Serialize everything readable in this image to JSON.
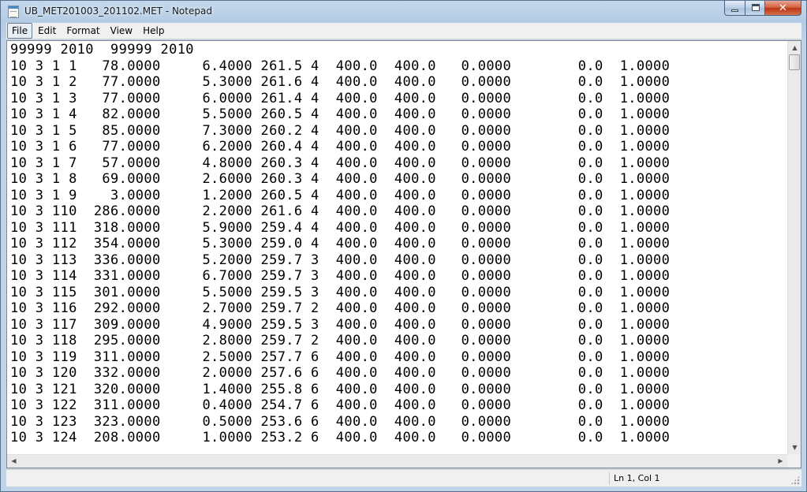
{
  "window": {
    "title": "UB_MET201003_201102.MET - Notepad",
    "app_icon": "notepad-icon",
    "controls": {
      "minimize_icon": "minimize-icon",
      "maximize_icon": "maximize-icon",
      "close_icon": "close-icon",
      "close_glyph": "✕"
    },
    "close_color": "#c7401f"
  },
  "menu": {
    "items": [
      {
        "label": "File"
      },
      {
        "label": "Edit"
      },
      {
        "label": "Format"
      },
      {
        "label": "View"
      },
      {
        "label": "Help"
      }
    ],
    "active_index": 0
  },
  "document": {
    "lines": [
      "99999 2010  99999 2010",
      "10 3 1 1   78.0000     6.4000 261.5 4  400.0  400.0   0.0000        0.0  1.0000",
      "10 3 1 2   77.0000     5.3000 261.6 4  400.0  400.0   0.0000        0.0  1.0000",
      "10 3 1 3   77.0000     6.0000 261.4 4  400.0  400.0   0.0000        0.0  1.0000",
      "10 3 1 4   82.0000     5.5000 260.5 4  400.0  400.0   0.0000        0.0  1.0000",
      "10 3 1 5   85.0000     7.3000 260.2 4  400.0  400.0   0.0000        0.0  1.0000",
      "10 3 1 6   77.0000     6.2000 260.4 4  400.0  400.0   0.0000        0.0  1.0000",
      "10 3 1 7   57.0000     4.8000 260.3 4  400.0  400.0   0.0000        0.0  1.0000",
      "10 3 1 8   69.0000     2.6000 260.3 4  400.0  400.0   0.0000        0.0  1.0000",
      "10 3 1 9    3.0000     1.2000 260.5 4  400.0  400.0   0.0000        0.0  1.0000",
      "10 3 110  286.0000     2.2000 261.6 4  400.0  400.0   0.0000        0.0  1.0000",
      "10 3 111  318.0000     5.9000 259.4 4  400.0  400.0   0.0000        0.0  1.0000",
      "10 3 112  354.0000     5.3000 259.0 4  400.0  400.0   0.0000        0.0  1.0000",
      "10 3 113  336.0000     5.2000 259.7 3  400.0  400.0   0.0000        0.0  1.0000",
      "10 3 114  331.0000     6.7000 259.7 3  400.0  400.0   0.0000        0.0  1.0000",
      "10 3 115  301.0000     5.5000 259.5 3  400.0  400.0   0.0000        0.0  1.0000",
      "10 3 116  292.0000     2.7000 259.7 2  400.0  400.0   0.0000        0.0  1.0000",
      "10 3 117  309.0000     4.9000 259.5 3  400.0  400.0   0.0000        0.0  1.0000",
      "10 3 118  295.0000     2.8000 259.7 2  400.0  400.0   0.0000        0.0  1.0000",
      "10 3 119  311.0000     2.5000 257.7 6  400.0  400.0   0.0000        0.0  1.0000",
      "10 3 120  332.0000     2.0000 257.6 6  400.0  400.0   0.0000        0.0  1.0000",
      "10 3 121  320.0000     1.4000 255.8 6  400.0  400.0   0.0000        0.0  1.0000",
      "10 3 122  311.0000     0.4000 254.7 6  400.0  400.0   0.0000        0.0  1.0000",
      "10 3 123  323.0000     0.5000 253.6 6  400.0  400.0   0.0000        0.0  1.0000",
      "10 3 124  208.0000     1.0000 253.2 6  400.0  400.0   0.0000        0.0  1.0000"
    ]
  },
  "scrollbars": {
    "up_icon": "scroll-up-arrow-icon",
    "down_icon": "scroll-down-arrow-icon",
    "left_icon": "scroll-left-arrow-icon",
    "right_icon": "scroll-right-arrow-icon",
    "up_glyph": "▲",
    "down_glyph": "▼",
    "left_glyph": "◀",
    "right_glyph": "▶"
  },
  "status": {
    "position": "Ln 1, Col 1"
  }
}
